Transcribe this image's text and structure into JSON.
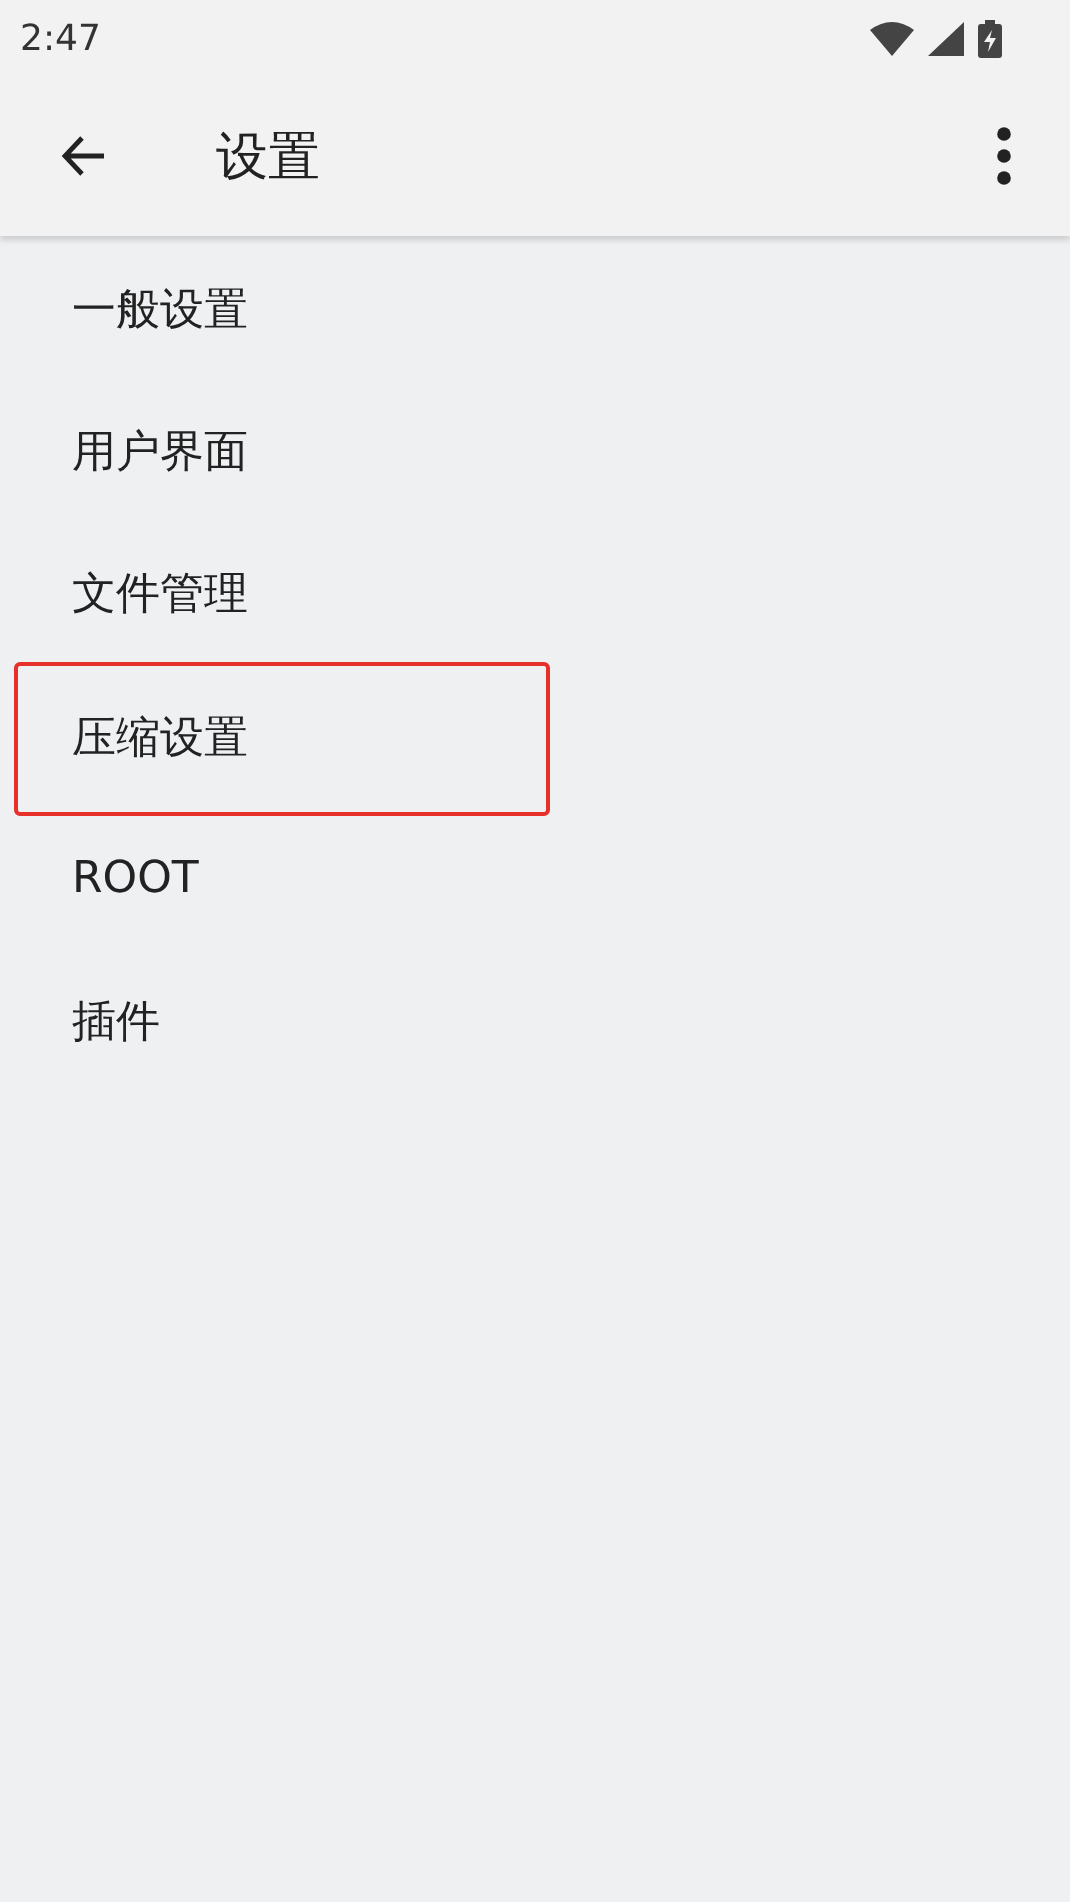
{
  "status_bar": {
    "time": "2:47"
  },
  "app_bar": {
    "title": "设置"
  },
  "items": [
    {
      "label": "一般设置",
      "highlighted": false
    },
    {
      "label": "用户界面",
      "highlighted": false
    },
    {
      "label": "文件管理",
      "highlighted": false
    },
    {
      "label": "压缩设置",
      "highlighted": true
    },
    {
      "label": "ROOT",
      "highlighted": false
    },
    {
      "label": "插件",
      "highlighted": false
    }
  ]
}
